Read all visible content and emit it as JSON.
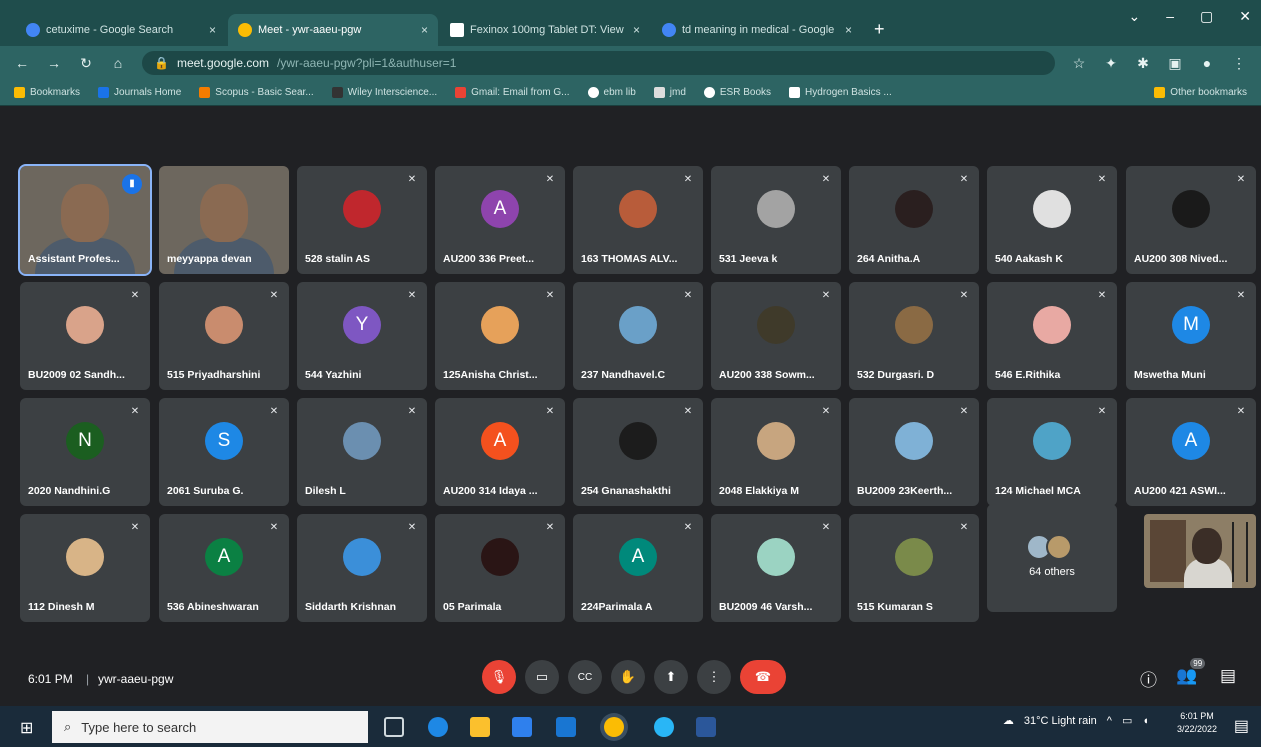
{
  "browser": {
    "tabs": [
      {
        "title": "cetuxime - Google Search",
        "fav": "#4285f4",
        "close": "×"
      },
      {
        "title": "Meet - ywr-aaeu-pgw",
        "fav": "#fbbc04",
        "close": "×"
      },
      {
        "title": "Fexinox 100mg Tablet DT: View",
        "fav": "#ffffff",
        "close": "×"
      },
      {
        "title": "td meaning in medical - Google",
        "fav": "#4285f4",
        "close": "×"
      }
    ],
    "new_tab": "+",
    "window_controls": [
      "⌄",
      "–",
      "▢",
      "✕"
    ],
    "url_host": "meet.google.com",
    "url_rest": "/ywr-aaeu-pgw?pli=1&authuser=1",
    "bookmarks": [
      {
        "label": "Bookmarks",
        "color": "#fbbc04"
      },
      {
        "label": "Journals Home",
        "color": "#1a73e8"
      },
      {
        "label": "Scopus - Basic Sear...",
        "color": "#f57c00"
      },
      {
        "label": "Wiley Interscience...",
        "color": "#333333"
      },
      {
        "label": "Gmail: Email from G...",
        "color": "#ea4335"
      },
      {
        "label": "ebm lib",
        "color": "#ffffff"
      },
      {
        "label": "jmd",
        "color": "#dddddd"
      },
      {
        "label": "ESR Books",
        "color": "#ffffff"
      },
      {
        "label": "Hydrogen Basics ...",
        "color": "#ffffff"
      }
    ],
    "other_bookmarks": "Other bookmarks"
  },
  "participants": [
    {
      "name": "Assistant Profes...",
      "type": "video",
      "speaking": true
    },
    {
      "name": "meyyappa devan",
      "type": "video",
      "speaking": false
    },
    {
      "name": "528 stalin AS",
      "type": "photo",
      "color": "#c0272d"
    },
    {
      "name": "AU200 336 Preet...",
      "type": "letter",
      "letter": "A",
      "color": "#8e44ad"
    },
    {
      "name": "163 THOMAS ALV...",
      "type": "photo",
      "color": "#b85c3a"
    },
    {
      "name": "531 Jeeva k",
      "type": "photo",
      "color": "#a3a3a3"
    },
    {
      "name": "264 Anitha.A",
      "type": "photo",
      "color": "#2a1f1f"
    },
    {
      "name": "540 Aakash K",
      "type": "photo",
      "color": "#e0e0e0"
    },
    {
      "name": "AU200 308 Nived...",
      "type": "photo",
      "color": "#1a1a1a"
    },
    {
      "name": "BU2009 02 Sandh...",
      "type": "photo",
      "color": "#d9a38a"
    },
    {
      "name": "515 Priyadharshini",
      "type": "photo",
      "color": "#c98c6e"
    },
    {
      "name": "544 Yazhini",
      "type": "letter",
      "letter": "Y",
      "color": "#7e57c2"
    },
    {
      "name": "125Anisha Christ...",
      "type": "photo",
      "color": "#e6a15a"
    },
    {
      "name": "237 Nandhavel.C",
      "type": "photo",
      "color": "#6aa0c8"
    },
    {
      "name": "AU200 338 Sowm...",
      "type": "photo",
      "color": "#3f3a2a"
    },
    {
      "name": "532 Durgasri. D",
      "type": "photo",
      "color": "#8a6a44"
    },
    {
      "name": "546 E.Rithika",
      "type": "photo",
      "color": "#e8a9a3"
    },
    {
      "name": "Mswetha Muni",
      "type": "letter",
      "letter": "M",
      "color": "#1e88e5"
    },
    {
      "name": "2020 Nandhini.G",
      "type": "letter",
      "letter": "N",
      "color": "#1b5e20"
    },
    {
      "name": "2061 Suruba G.",
      "type": "letter",
      "letter": "S",
      "color": "#1e88e5"
    },
    {
      "name": "Dilesh L",
      "type": "photo",
      "color": "#6b8fb0"
    },
    {
      "name": "AU200 314 Idaya ...",
      "type": "letter",
      "letter": "A",
      "color": "#f4511e"
    },
    {
      "name": "254 Gnanashakthi",
      "type": "photo",
      "color": "#1c1c1c"
    },
    {
      "name": "2048 Elakkiya M",
      "type": "photo",
      "color": "#c7a57f"
    },
    {
      "name": "BU2009 23Keerth...",
      "type": "photo",
      "color": "#7fb1d6"
    },
    {
      "name": "124 Michael MCA",
      "type": "photo",
      "color": "#4fa3c7"
    },
    {
      "name": "AU200 421 ASWI...",
      "type": "letter",
      "letter": "A",
      "color": "#1e88e5"
    },
    {
      "name": "112 Dinesh M",
      "type": "photo",
      "color": "#d8b487"
    },
    {
      "name": "536 Abineshwaran",
      "type": "letter",
      "letter": "A",
      "color": "#0b8043"
    },
    {
      "name": "Siddarth Krishnan",
      "type": "photo",
      "color": "#3b8fd9"
    },
    {
      "name": "05 Parimala",
      "type": "photo",
      "color": "#2a1515"
    },
    {
      "name": "224Parimala A",
      "type": "letter",
      "letter": "A",
      "color": "#00897b"
    },
    {
      "name": "BU2009 46 Varsh...",
      "type": "photo",
      "color": "#9bd3c2"
    },
    {
      "name": "515 Kumaran S",
      "type": "photo",
      "color": "#7a8a4a"
    }
  ],
  "others": {
    "label": "64 others"
  },
  "meeting": {
    "time": "6:01 PM",
    "separator": "|",
    "code": "ywr-aaeu-pgw"
  },
  "controls": {
    "mic": "🎙",
    "camera": "▭",
    "captions": "CC",
    "hand": "✋",
    "present": "⬆",
    "more": "⋮",
    "hangup": "☎"
  },
  "right_controls": {
    "info": "ⓘ",
    "people": "👥",
    "people_count": "99",
    "chat": "▤"
  },
  "taskbar": {
    "search_placeholder": "Type here to search",
    "weather": "31°C  Light rain",
    "time": "6:01 PM",
    "date": "3/22/2022"
  }
}
